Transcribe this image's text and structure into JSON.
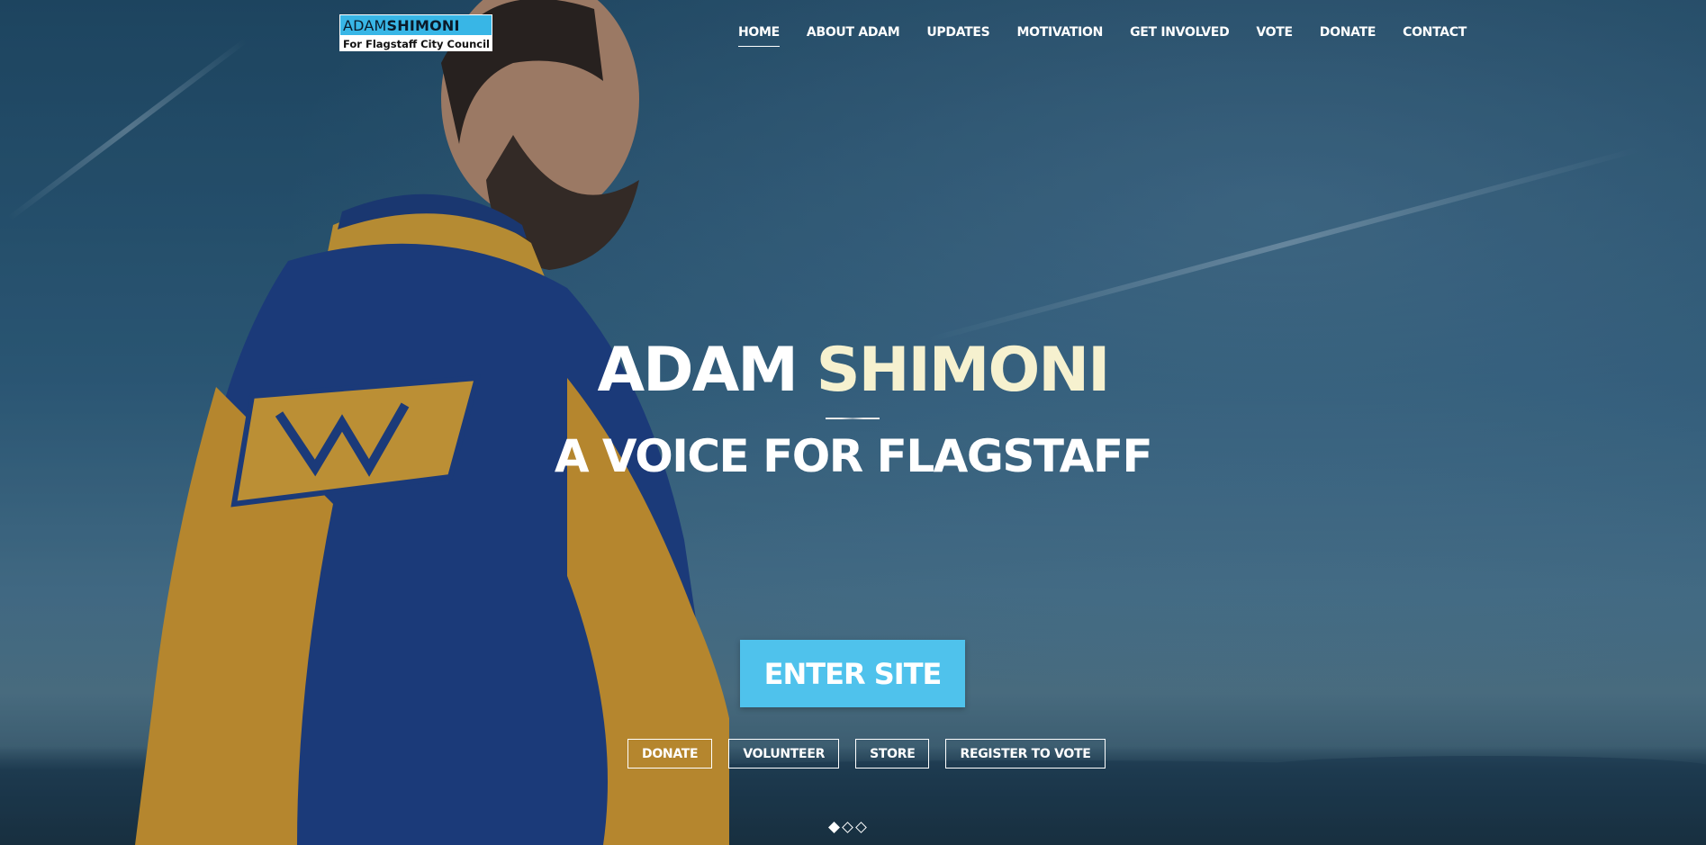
{
  "logo": {
    "first": "ADAM",
    "last": "SHIMONI",
    "tagline": "For Flagstaff City Council"
  },
  "nav": {
    "items": [
      {
        "label": "HOME",
        "active": true
      },
      {
        "label": "ABOUT ADAM"
      },
      {
        "label": "UPDATES"
      },
      {
        "label": "MOTIVATION"
      },
      {
        "label": "GET INVOLVED"
      },
      {
        "label": "VOTE"
      },
      {
        "label": "DONATE"
      },
      {
        "label": "CONTACT"
      }
    ]
  },
  "hero": {
    "title_first": "ADAM",
    "title_last": "SHIMONI",
    "subtitle": "A VOICE FOR FLAGSTAFF",
    "enter_label": "ENTER SITE",
    "buttons": [
      "DONATE",
      "VOLUNTEER",
      "STORE",
      "REGISTER TO VOTE"
    ]
  },
  "slider": {
    "count": 3,
    "active": 1
  },
  "colors": {
    "accent": "#4fc2ec",
    "title_accent": "#f6f1cf",
    "logo_blue": "#38b6e6"
  }
}
